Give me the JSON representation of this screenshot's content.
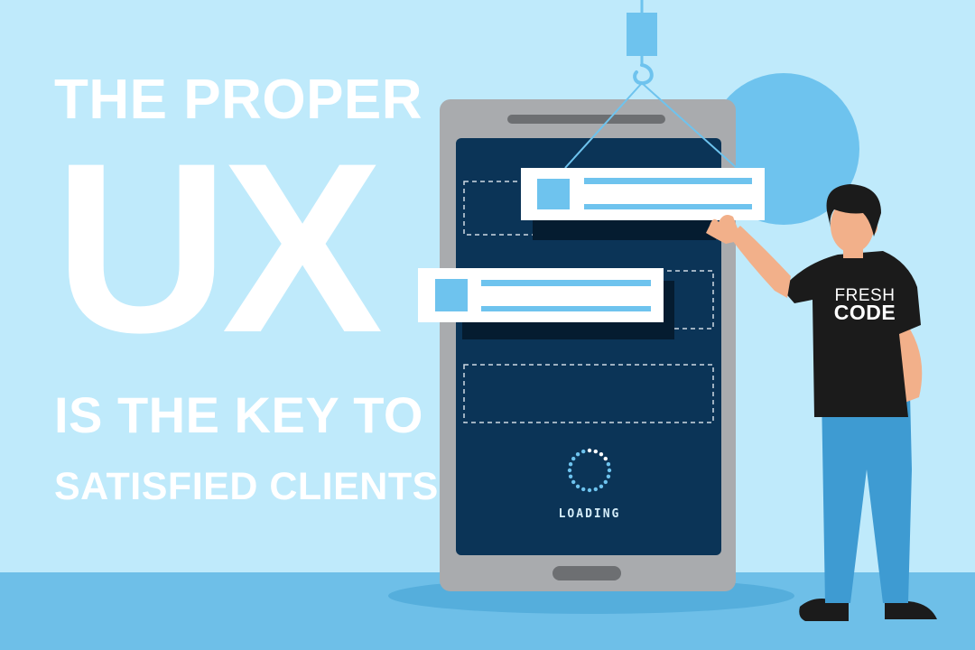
{
  "headline": {
    "line1": "THE PROPER",
    "line2": "UX",
    "line3": "IS THE KEY TO",
    "line4": "SATISFIED CLIENTS"
  },
  "phone": {
    "loading_label": "LOADING"
  },
  "character": {
    "shirt_line1": "FRESH",
    "shirt_line2": "CODE"
  },
  "colors": {
    "background": "#bfeafb",
    "floor": "#6ebfe8",
    "phone_frame": "#a9abae",
    "phone_screen": "#0b3457",
    "accent_blue": "#6ec3ee",
    "headline_text": "#ffffff"
  },
  "icons": [
    "crane-hook-icon",
    "loading-spinner-icon"
  ]
}
